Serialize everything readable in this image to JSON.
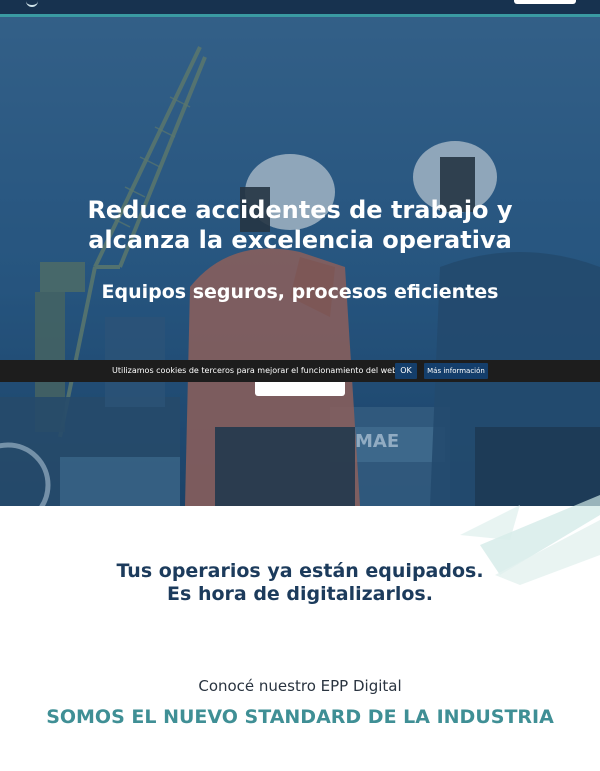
{
  "hero": {
    "title_line1": "Reduce accidentes de trabajo y",
    "title_line2": "alcanza la excelencia operativa",
    "subtitle": "Equipos seguros, procesos eficientes",
    "container_text": "MAE"
  },
  "cookie_bar": {
    "message": "Utilizamos cookies de terceros para mejorar el funcionamiento del website",
    "ok_label": "OK",
    "more_info_label": "Más información"
  },
  "section": {
    "tagline_line1": "Tus operarios ya están equipados.",
    "tagline_line2": "Es hora de digitalizarlos.",
    "intro": "Conocé nuestro EPP Digital",
    "headline": "SOMOS EL NUEVO STANDARD DE LA INDUSTRIA"
  },
  "colors": {
    "navy": "#17324f",
    "teal_accent": "#3a9aa2",
    "hero_overlay": "#1e4a72",
    "cookie_bg": "#1d1d1d",
    "cookie_button": "#143e6b",
    "headline_teal": "#3f8f95",
    "tagline_navy": "#1c3b5c"
  },
  "icons": [
    "logo-icon",
    "menu-button"
  ]
}
